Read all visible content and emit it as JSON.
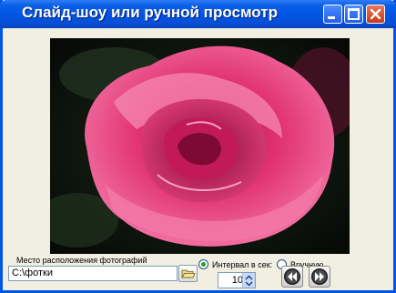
{
  "window": {
    "title": "Слайд-шоу или ручной просмотр"
  },
  "titlebar_buttons": [
    "minimize-icon",
    "maximize-icon",
    "close-icon"
  ],
  "photo": {
    "subject": "rose",
    "color": "#e8337a"
  },
  "location": {
    "label": "Место расположения фотографий",
    "value": "C:\\фотки"
  },
  "mode": {
    "interval_label": "Интервал в сек:",
    "interval_selected": true,
    "manual_label": "Вручную",
    "manual_selected": false,
    "interval_value": "10"
  },
  "nav": {
    "prev_icon": "rewind-icon",
    "next_icon": "fast-forward-icon"
  }
}
